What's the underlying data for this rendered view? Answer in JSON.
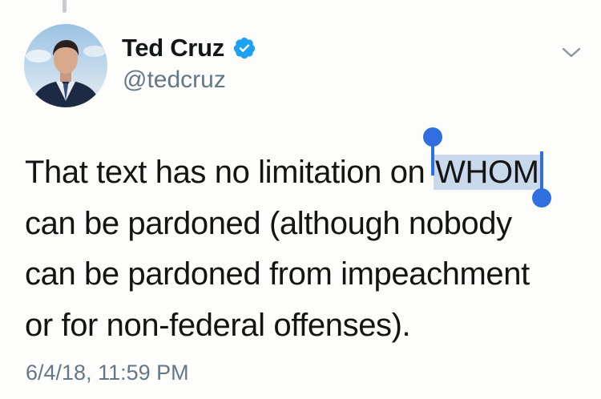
{
  "tweet": {
    "author": {
      "display_name": "Ted Cruz",
      "handle": "@tedcruz",
      "verified": true
    },
    "text_lines": {
      "line1_before": "That text has no limitation on ",
      "line1_selected": "WHOM",
      "line2": "can be pardoned (although nobody",
      "line3": "can be pardoned from impeachment",
      "line4": "or for non-federal offenses)."
    },
    "timestamp": "6/4/18, 11:59 PM"
  },
  "icons": {
    "verified": "verified-badge-icon",
    "menu": "chevron-down-icon"
  },
  "colors": {
    "verified_blue": "#1da1f2",
    "selection_handle": "#2f6fe0",
    "selection_highlight": "#c9d8eb",
    "secondary_text": "#657786"
  }
}
